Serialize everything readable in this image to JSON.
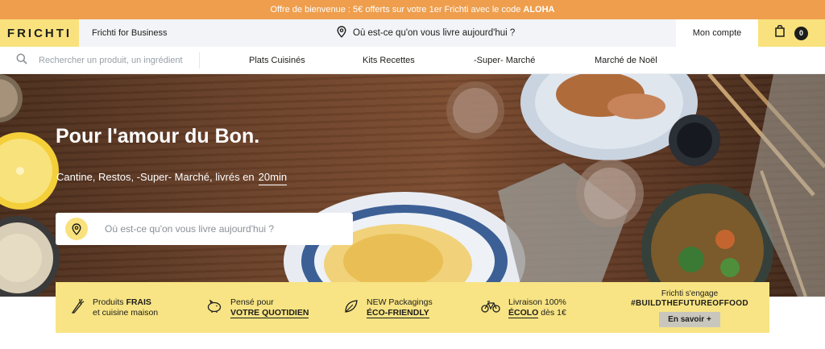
{
  "promo": {
    "text": "Offre de bienvenue : 5€ offerts sur votre 1er Frichti avec le code ",
    "code": "ALOHA"
  },
  "header": {
    "logo": "FRICHTI",
    "business_link": "Frichti for Business",
    "delivery_prompt": "Où est-ce qu'on vous livre aujourd'hui ?",
    "account": "Mon compte",
    "cart_count": "0"
  },
  "search": {
    "placeholder": "Rechercher un produit, un ingrédient",
    "icon": "search-icon"
  },
  "nav": {
    "items": [
      "Plats Cuisinés",
      "Kits Recettes",
      "-Super- Marché",
      "Marché de Noël"
    ]
  },
  "hero": {
    "title": "Pour l'amour du Bon.",
    "subtitle": "Cantine, Restos, -Super- Marché, livrés en",
    "subtitle_highlight": "20min",
    "search_placeholder": "Où est-ce qu'on vous livre aujourd'hui ?"
  },
  "features": [
    {
      "icon": "carrot-icon",
      "line1": "Produits ",
      "line1_bold": "FRAIS",
      "line2": "et cuisine maison"
    },
    {
      "icon": "piggy-bank-icon",
      "line1": "Pensé pour",
      "line2_bold": "VOTRE QUOTIDIEN"
    },
    {
      "icon": "leaf-icon",
      "line1": "NEW Packagings",
      "line2_bold": "ÉCO-FRIENDLY"
    },
    {
      "icon": "bicycle-icon",
      "line1": "Livraison 100%",
      "line2_bold": "ÉCOLO",
      "line2": " dès 1€"
    }
  ],
  "engage": {
    "line1": "Frichti s'engage",
    "tag": "#BUILDTHEFUTUREOFFOOD",
    "button": "En savoir +"
  },
  "colors": {
    "promo_bar": "#ef9e4d",
    "brand_yellow": "#f9e27d",
    "feature_bar": "#f8e484",
    "topbar": "#f2f4f7"
  }
}
